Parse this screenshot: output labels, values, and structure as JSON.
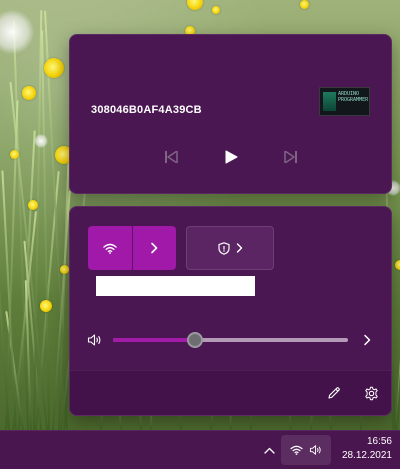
{
  "media": {
    "title": "308046B0AF4A39CB",
    "album_art": {
      "alt_icon": "album-art-thumbnail",
      "text_lines": [
        "ARDUINO",
        "PROGRAMMER"
      ]
    },
    "controls": {
      "previous_icon": "skip-previous-icon",
      "play_icon": "play-icon",
      "next_icon": "skip-next-icon"
    }
  },
  "quick_settings": {
    "wifi_tile": {
      "icon": "wifi-icon",
      "expand_icon": "chevron-right-icon",
      "active": true
    },
    "vpn_tile": {
      "icon": "shield-icon",
      "expand_icon": "chevron-right-icon"
    },
    "tile_label": "",
    "volume": {
      "icon": "speaker-icon",
      "level_fraction": 0.35,
      "expand_icon": "chevron-right-icon"
    },
    "footer": {
      "edit_icon": "pencil-icon",
      "settings_icon": "gear-icon"
    }
  },
  "taskbar": {
    "overflow_icon": "chevron-up-icon",
    "status_icons": [
      "wifi-icon",
      "speaker-icon"
    ],
    "time": "16:56",
    "date": "28.12.2021"
  },
  "colors": {
    "panel_bg": "#4b1752",
    "accent": "#a019a8",
    "taskbar_bg": "#4a1650",
    "slider_track": "#b39ab7"
  }
}
